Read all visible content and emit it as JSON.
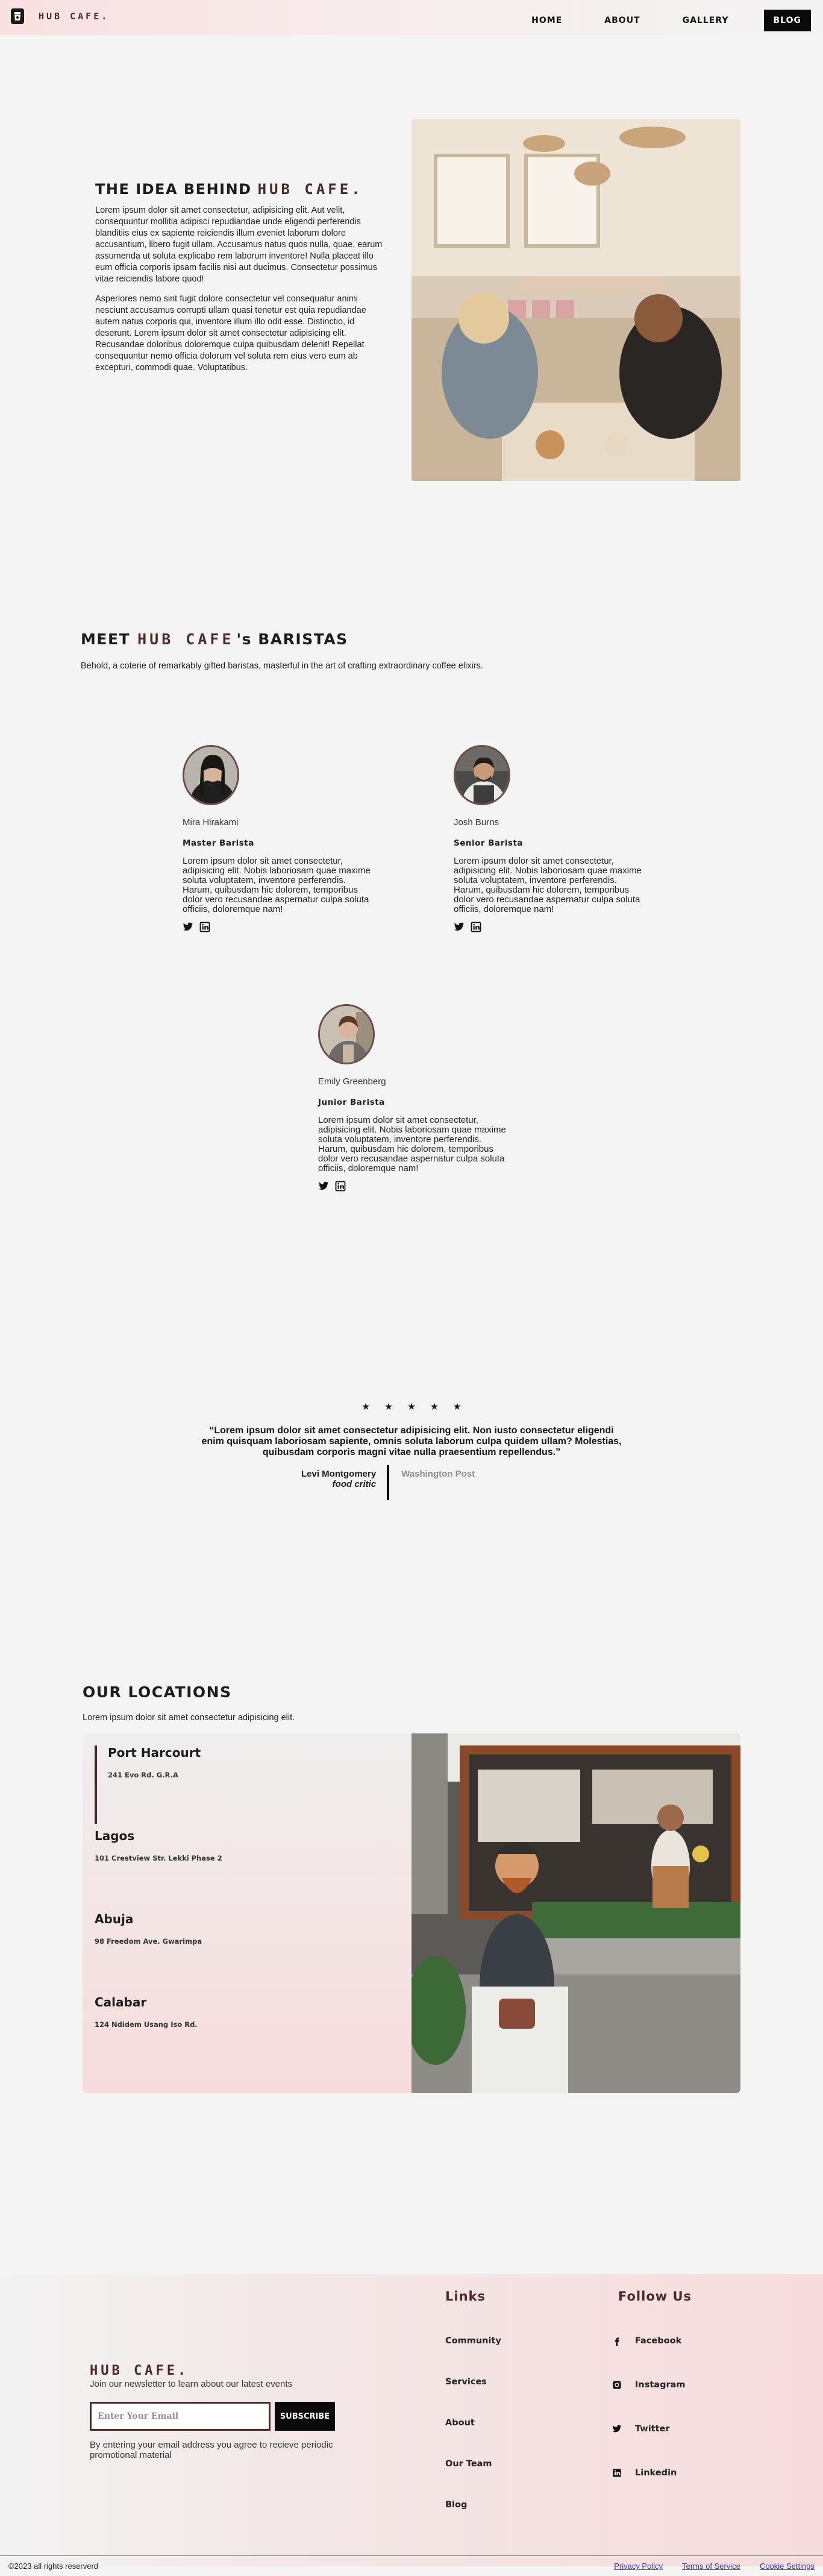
{
  "nav": {
    "logo_icon": "coffee-cup-icon",
    "brand": "HUB CAFE.",
    "links": [
      "HOME",
      "ABOUT",
      "GALLERY",
      "BLOG"
    ]
  },
  "about": {
    "title_prefix": "THE IDEA BEHIND",
    "title_brand": "HUB CAFE.",
    "paragraph_1": "Lorem ipsum dolor sit amet consectetur, adipisicing elit. Aut velit, consequuntur mollitia adipisci repudiandae unde eligendi perferendis blanditiis eius ex sapiente reiciendis illum eveniet laborum dolore accusantium, libero fugit ullam. Accusamus natus quos nulla, quae, earum assumenda ut soluta explicabo rem laborum inventore! Nulla placeat illo eum officia corporis ipsam facilis nisi aut ducimus. Consectetur possimus vitae reiciendis labore quod!",
    "paragraph_2": "Asperiores nemo sint fugit dolore consectetur vel consequatur animi nesciunt accusamus corrupti ullam quasi tenetur est quia repudiandae autem natus corporis qui, inventore illum illo odit esse. Distinctio, id deserunt. Lorem ipsum dolor sit amet consectetur adipisicing elit. Recusandae doloribus doloremque culpa quibusdam delenit! Repellat consequuntur nemo officia dolorum vel soluta rem eius vero eum ab excepturi, commodi quae. Voluptatibus."
  },
  "baristas": {
    "title_prefix": "MEET",
    "title_brand": "HUB CAFE",
    "title_suffix": "'s BARISTAS",
    "subtitle": "Behold, a coterie of remarkably gifted baristas, masterful in the art of crafting extraordinary coffee elixirs.",
    "members": [
      {
        "name": "Mira Hirakami",
        "role": "Master Barista",
        "bio": "Lorem ipsum dolor sit amet consectetur, adipisicing elit. Nobis laboriosam quae maxime soluta voluptatem, inventore perferendis. Harum, quibusdam hic dolorem, temporibus dolor vero recusandae aspernatur culpa soluta officiis, doloremque nam!"
      },
      {
        "name": "Josh Burns",
        "role": "Senior Barista",
        "bio": "Lorem ipsum dolor sit amet consectetur, adipisicing elit. Nobis laboriosam quae maxime soluta voluptatem, inventore perferendis. Harum, quibusdam hic dolorem, temporibus dolor vero recusandae aspernatur culpa soluta officiis, doloremque nam!"
      },
      {
        "name": "Emily Greenberg",
        "role": "Junior Barista",
        "bio": "Lorem ipsum dolor sit amet consectetur, adipisicing elit. Nobis laboriosam quae maxime soluta voluptatem, inventore perferendis. Harum, quibusdam hic dolorem, temporibus dolor vero recusandae aspernatur culpa soluta officiis, doloremque nam!"
      }
    ]
  },
  "testimonial": {
    "stars": [
      "★",
      "★",
      "★",
      "★",
      "★"
    ],
    "quote": "“Lorem ipsum dolor sit amet consectetur adipisicing elit. Non iusto consectetur eligendi enim quisquam laboriosam sapiente, omnis soluta laborum culpa quidem ullam? Molestias, quibusdam corporis magni vitae nulla praesentium repellendus.”",
    "critic_name": "Levi Montgomery",
    "critic_title": "food critic",
    "publication": "Washington Post"
  },
  "locations": {
    "title": "OUR LOCATIONS",
    "subtitle": "Lorem ipsum dolor sit amet consectetur adipisicing elit.",
    "items": [
      {
        "city": "Port Harcourt",
        "address": "241 Evo Rd. G.R.A"
      },
      {
        "city": "Lagos",
        "address": "101 Crestview Str. Lekki Phase 2"
      },
      {
        "city": "Abuja",
        "address": "98 Freedom Ave. Gwarimpa"
      },
      {
        "city": "Calabar",
        "address": "124 Ndidem Usang Iso Rd."
      }
    ]
  },
  "footer": {
    "brand": "HUB CAFE.",
    "newsletter": "Join our newsletter to learn about our latest events",
    "email_placeholder": "Enter Your Email",
    "subscribe": "SUBSCRIBE",
    "consent": "By entering your email address you agree to recieve periodic promotional material",
    "links_title": "Links",
    "links": [
      "Community",
      "Services",
      "About",
      "Our Team",
      "Blog"
    ],
    "follow_title": "Follow Us",
    "socials": [
      "Facebook",
      "Instagram",
      "Twitter",
      "Linkedin"
    ],
    "copyright": "©2023 all rights reserverd",
    "legal": [
      "Privacy Policy",
      "Terms of Service",
      "Cookie Settings"
    ]
  },
  "colors": {
    "brand": "#4a2a24",
    "accent_pink": "#f7dcdd",
    "button_black": "#0a0a0a",
    "link_blue": "#3730d6"
  }
}
